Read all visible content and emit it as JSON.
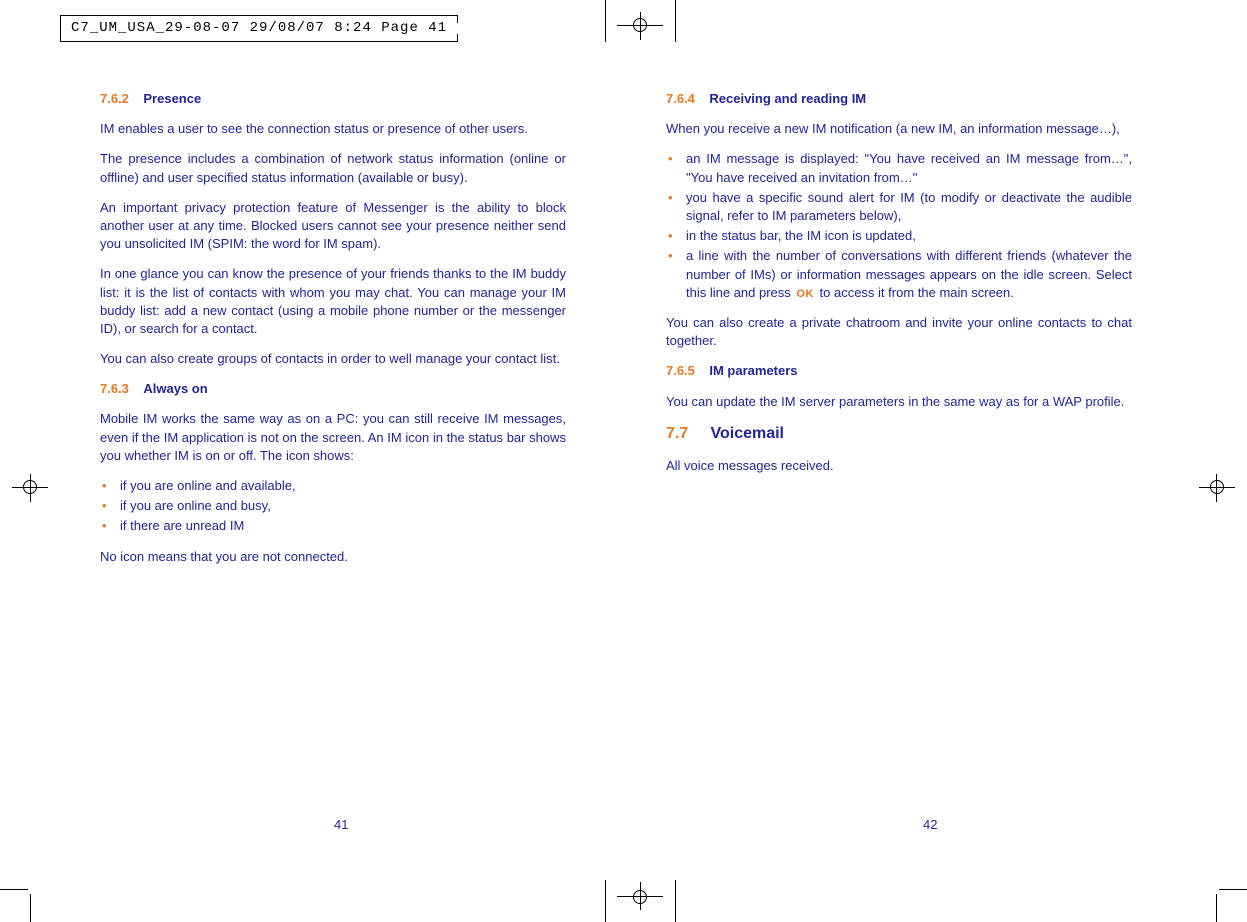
{
  "printers_mark": "C7_UM_USA_29-08-07  29/08/07  8:24  Page 41",
  "left": {
    "sec_762_num": "7.6.2",
    "sec_762_title": "Presence",
    "p1": "IM enables a user to see the connection status or presence of other users.",
    "p2": "The presence includes a combination of network status information (online or offline) and user specified status information (available or busy).",
    "p3": "An important privacy protection feature of Messenger is the ability to block another user at any time. Blocked users cannot see your presence neither send you unsolicited IM (SPIM: the word for IM spam).",
    "p4": "In one glance you can know the presence of your friends thanks to the IM buddy list: it is the list of contacts with whom you may chat. You can manage your IM buddy list: add a new contact (using a mobile phone number or the messenger ID), or search for a contact.",
    "p5": "You can also create groups of contacts in order to well manage your contact list.",
    "sec_763_num": "7.6.3",
    "sec_763_title": "Always on",
    "p6": "Mobile IM works the same way as on a PC: you can still receive IM messages, even if the IM application is not on the screen. An IM icon in the status bar shows you whether IM is on or off. The icon shows:",
    "li1": "if you are online and available,",
    "li2": "if you are online and busy,",
    "li3": "if there are unread IM",
    "p7": "No icon means that you are not connected.",
    "page_number": "41"
  },
  "right": {
    "sec_764_num": "7.6.4",
    "sec_764_title": "Receiving and reading IM",
    "p1": "When you receive a new IM notification (a new IM, an information message…),",
    "li1": "an IM message is displayed: \"You have received an IM message from…\", \"You have received an invitation from…\"",
    "li2": "you have a specific sound alert for IM (to modify or deactivate the audible signal, refer to IM parameters below),",
    "li3": "in the status bar, the IM icon is updated,",
    "li4a": "a line with the number of conversations with different friends (whatever the number of IMs) or information messages appears on the idle screen. Select this line and press ",
    "ok_label": "OK",
    "li4b": " to access it from the main screen.",
    "p2": "You can also create a private chatroom and invite your online contacts to chat together.",
    "sec_765_num": "7.6.5",
    "sec_765_title": "IM parameters",
    "p3": "You can update the IM server parameters in the same way as for a WAP profile.",
    "sec_77_num": "7.7",
    "sec_77_title": "Voicemail",
    "p4": "All voice messages received.",
    "page_number": "42"
  }
}
